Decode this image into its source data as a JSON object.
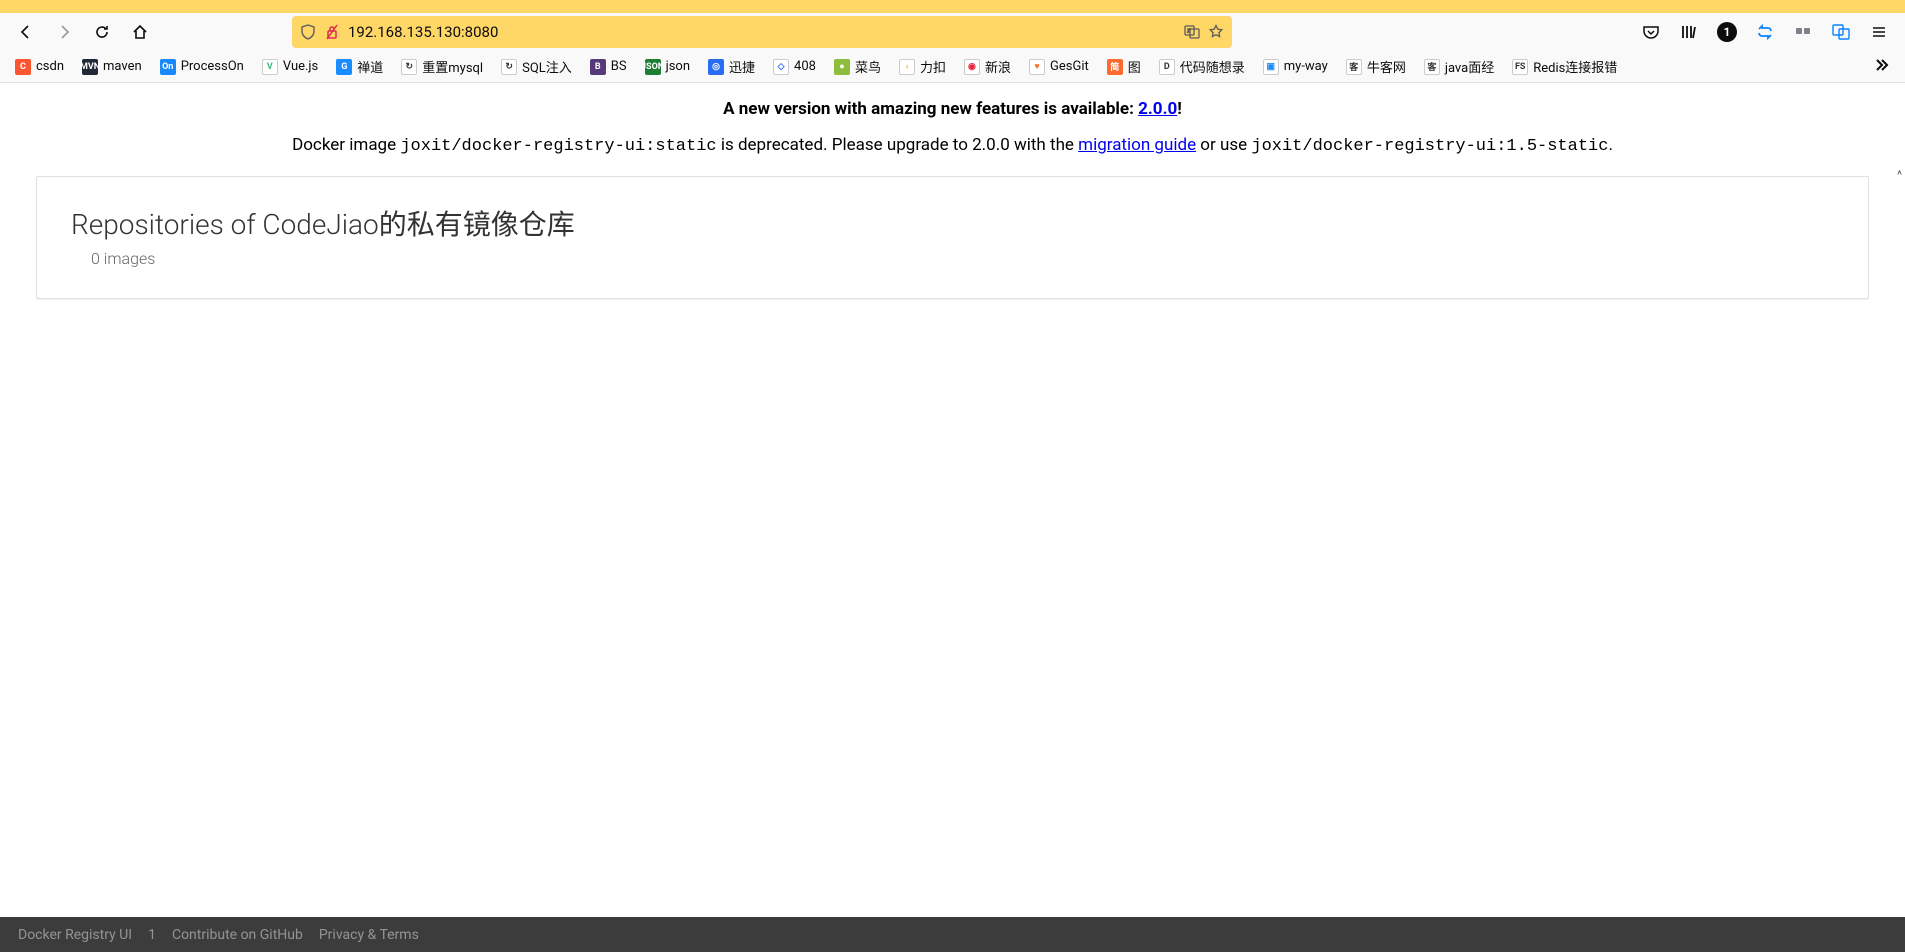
{
  "browser": {
    "url": "192.168.135.130:8080",
    "notification_count": "1"
  },
  "bookmarks": [
    {
      "label": "csdn",
      "icon_bg": "#fc5531",
      "icon_text": "C"
    },
    {
      "label": "maven",
      "icon_bg": "#1f2937",
      "icon_text": "MVN"
    },
    {
      "label": "ProcessOn",
      "icon_bg": "#1989fa",
      "icon_text": "On"
    },
    {
      "label": "Vue.js",
      "icon_bg": "#fff",
      "icon_text": "V",
      "icon_color": "#42b882"
    },
    {
      "label": "禅道",
      "icon_bg": "#1b8cff",
      "icon_text": "G"
    },
    {
      "label": "重置mysql",
      "icon_bg": "#fff",
      "icon_text": "↻",
      "icon_color": "#333"
    },
    {
      "label": "SQL注入",
      "icon_bg": "#fff",
      "icon_text": "↻",
      "icon_color": "#333"
    },
    {
      "label": "BS",
      "icon_bg": "#563a7c",
      "icon_text": "B"
    },
    {
      "label": "json",
      "icon_bg": "#1e7e34",
      "icon_text": "JSON"
    },
    {
      "label": "迅捷",
      "icon_bg": "#2a6df5",
      "icon_text": "◎"
    },
    {
      "label": "408",
      "icon_bg": "#fff",
      "icon_text": "◇",
      "icon_color": "#2a6df5"
    },
    {
      "label": "菜鸟",
      "icon_bg": "#8ebd3d",
      "icon_text": "●"
    },
    {
      "label": "力扣",
      "icon_bg": "#fff",
      "icon_text": "‹",
      "icon_color": "#fca41a"
    },
    {
      "label": "新浪",
      "icon_bg": "#fff",
      "icon_text": "◉",
      "icon_color": "#eb213a"
    },
    {
      "label": "GesGit",
      "icon_bg": "#fff",
      "icon_text": "♥",
      "icon_color": "#fc6d27"
    },
    {
      "label": "图",
      "icon_bg": "#fc6c30",
      "icon_text": "简"
    },
    {
      "label": "代码随想录",
      "icon_bg": "#fff",
      "icon_text": "D",
      "icon_color": "#333"
    },
    {
      "label": "my-way",
      "icon_bg": "#fff",
      "icon_text": "▣",
      "icon_color": "#1989fa"
    },
    {
      "label": "牛客网",
      "icon_bg": "#fff",
      "icon_text": "客",
      "icon_color": "#333"
    },
    {
      "label": "java面经",
      "icon_bg": "#fff",
      "icon_text": "客",
      "icon_color": "#333"
    },
    {
      "label": "Redis连接报错",
      "icon_bg": "#fff",
      "icon_text": "FS",
      "icon_color": "#333"
    }
  ],
  "banner": {
    "prefix": "A new version with amazing new features is available: ",
    "version_link": "2.0.0",
    "suffix": "!"
  },
  "deprecation": {
    "t1": "Docker image ",
    "code1": "joxit/docker-registry-ui:static",
    "t2": " is deprecated. Please upgrade to 2.0.0 with the ",
    "link": "migration guide",
    "t3": " or use ",
    "code2": "joxit/docker-registry-ui:1.5-static",
    "t4": "."
  },
  "card": {
    "title": "Repositories of CodeJiao的私有镜像仓库",
    "subtitle": "0 images"
  },
  "footer": {
    "app": "Docker Registry UI",
    "version": "1",
    "contribute": "Contribute on GitHub",
    "privacy": "Privacy & Terms"
  }
}
